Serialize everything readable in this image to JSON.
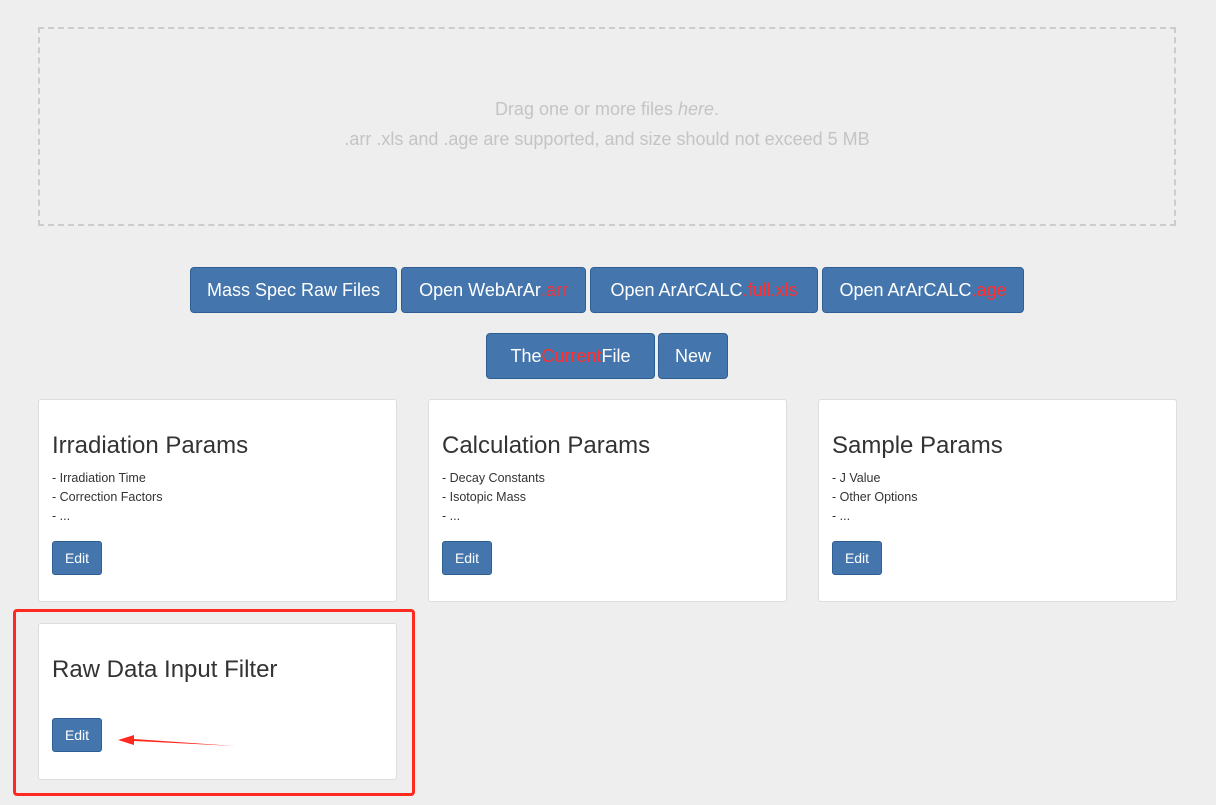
{
  "dropzone": {
    "line1_text": "Drag one or more files ",
    "line1_em": "here",
    "line1_end": ".",
    "line2": ".arr .xls and .age are supported, and size should not exceed 5 MB"
  },
  "buttons": {
    "mass_spec": "Mass Spec Raw Files",
    "webarar_prefix": "Open WebArAr",
    "webarar_ext": ".arr",
    "fullxls_prefix": "Open ArArCALC",
    "fullxls_ext": ".full.xls",
    "age_prefix": "Open ArArCALC",
    "age_ext": ".age",
    "current_pre": "The ",
    "current_hl": "Current",
    "current_post": " File",
    "new": "New"
  },
  "cards": [
    {
      "title": "Irradiation Params",
      "items": [
        "- Irradiation Time",
        "- Correction Factors",
        "- ..."
      ],
      "edit": "Edit"
    },
    {
      "title": "Calculation Params",
      "items": [
        "- Decay Constants",
        "- Isotopic Mass",
        "- ..."
      ],
      "edit": "Edit"
    },
    {
      "title": "Sample Params",
      "items": [
        "- J Value",
        "- Other Options",
        "- ..."
      ],
      "edit": "Edit"
    },
    {
      "title": "Raw Data Input Filter",
      "edit": "Edit"
    }
  ],
  "colors": {
    "button": "#4476ad",
    "highlight_text": "#ff3030",
    "annotation": "#ff2a1f"
  }
}
